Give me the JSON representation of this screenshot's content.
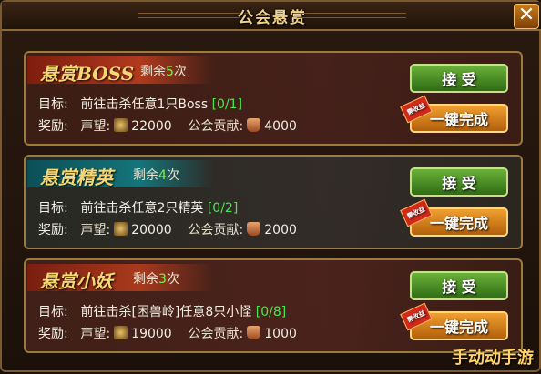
{
  "window": {
    "title": "公会悬赏",
    "close_label": "✕"
  },
  "bounties": [
    {
      "name": "悬赏BOSS",
      "remain_prefix": "剩余",
      "remain_num": "5",
      "remain_suffix": "次",
      "target_label": "目标:",
      "target_text": "前往击杀任意1只Boss",
      "progress": "[0/1]",
      "reward_label": "奖励:",
      "rep_label": "声望:",
      "rep_value": "22000",
      "contrib_label": "公会贡献:",
      "contrib_value": "4000",
      "accept_label": "接 受",
      "complete_label": "一键完成",
      "complete_tag": "需收益"
    },
    {
      "name": "悬赏精英",
      "remain_prefix": "剩余",
      "remain_num": "4",
      "remain_suffix": "次",
      "target_label": "目标:",
      "target_text": "前往击杀任意2只精英",
      "progress": "[0/2]",
      "reward_label": "奖励:",
      "rep_label": "声望:",
      "rep_value": "20000",
      "contrib_label": "公会贡献:",
      "contrib_value": "2000",
      "accept_label": "接 受",
      "complete_label": "一键完成",
      "complete_tag": "需收益"
    },
    {
      "name": "悬赏小妖",
      "remain_prefix": "剩余",
      "remain_num": "3",
      "remain_suffix": "次",
      "target_label": "目标:",
      "target_text": "前往击杀[困兽岭]任意8只小怪",
      "progress": "[0/8]",
      "reward_label": "奖励:",
      "rep_label": "声望:",
      "rep_value": "19000",
      "contrib_label": "公会贡献:",
      "contrib_value": "1000",
      "accept_label": "接 受",
      "complete_label": "一键完成",
      "complete_tag": "需收益"
    }
  ],
  "watermark": "手动动手游",
  "icons": {
    "reputation": "reputation-icon",
    "contribution": "contribution-icon",
    "close": "close-icon"
  }
}
